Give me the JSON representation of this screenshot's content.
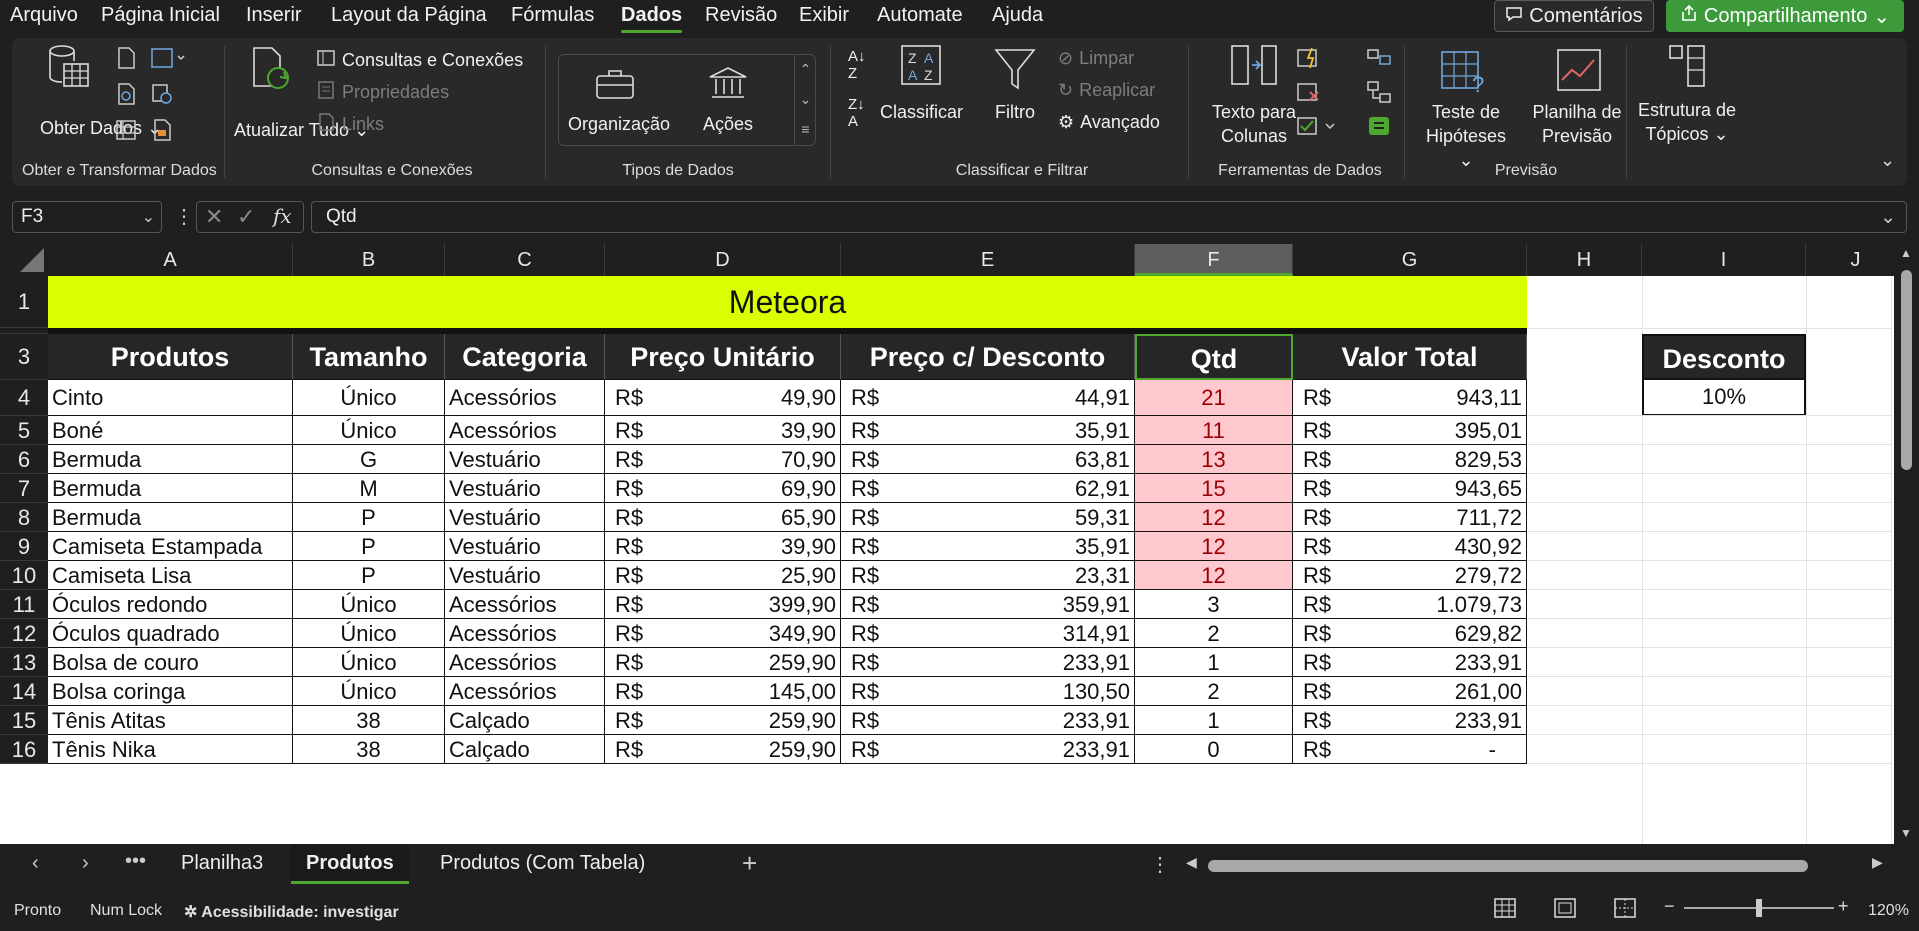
{
  "menu": [
    "Arquivo",
    "Página Inicial",
    "Inserir",
    "Layout da Página",
    "Fórmulas",
    "Dados",
    "Revisão",
    "Exibir",
    "Automate",
    "Ajuda"
  ],
  "active_menu": "Dados",
  "comments_label": "Comentários",
  "share_label": "Compartilhamento",
  "ribbon": {
    "obter_dados": "Obter Dados",
    "atualizar_tudo": "Atualizar Tudo",
    "consultas_conexoes_btn": "Consultas e Conexões",
    "propriedades": "Propriedades",
    "links": "Links",
    "organizacao": "Organização",
    "acoes": "Ações",
    "classificar": "Classificar",
    "filtro": "Filtro",
    "limpar": "Limpar",
    "reaplicar": "Reaplicar",
    "avancado": "Avançado",
    "texto_para_colunas": "Texto para Colunas",
    "teste_hipoteses": "Teste de Hipóteses",
    "planilha_previsao": "Planilha de Previsão",
    "estrutura_topicos": "Estrutura de Tópicos",
    "groups": {
      "obter": "Obter e Transformar Dados",
      "consultas": "Consultas e Conexões",
      "tipos": "Tipos de Dados",
      "classificar": "Classificar e Filtrar",
      "ferramentas": "Ferramentas de Dados",
      "previsao": "Previsão"
    }
  },
  "name_box": "F3",
  "formula_value": "Qtd",
  "columns": [
    "A",
    "B",
    "C",
    "D",
    "E",
    "F",
    "G",
    "H",
    "I",
    "J"
  ],
  "selected_column": "F",
  "title": "Meteora",
  "headers": [
    "Produtos",
    "Tamanho",
    "Categoria",
    "Preço Unitário",
    "Preço c/ Desconto",
    "Qtd",
    "Valor Total"
  ],
  "currency": "R$",
  "rows": [
    {
      "n": "4",
      "produto": "Cinto",
      "tamanho": "Único",
      "categoria": "Acessórios",
      "preco": "49,90",
      "desconto": "44,91",
      "qtd": "21",
      "total": "943,11"
    },
    {
      "n": "5",
      "produto": "Boné",
      "tamanho": "Único",
      "categoria": "Acessórios",
      "preco": "39,90",
      "desconto": "35,91",
      "qtd": "11",
      "total": "395,01"
    },
    {
      "n": "6",
      "produto": "Bermuda",
      "tamanho": "G",
      "categoria": "Vestuário",
      "preco": "70,90",
      "desconto": "63,81",
      "qtd": "13",
      "total": "829,53"
    },
    {
      "n": "7",
      "produto": "Bermuda",
      "tamanho": "M",
      "categoria": "Vestuário",
      "preco": "69,90",
      "desconto": "62,91",
      "qtd": "15",
      "total": "943,65"
    },
    {
      "n": "8",
      "produto": "Bermuda",
      "tamanho": "P",
      "categoria": "Vestuário",
      "preco": "65,90",
      "desconto": "59,31",
      "qtd": "12",
      "total": "711,72"
    },
    {
      "n": "9",
      "produto": "Camiseta Estampada",
      "tamanho": "P",
      "categoria": "Vestuário",
      "preco": "39,90",
      "desconto": "35,91",
      "qtd": "12",
      "total": "430,92"
    },
    {
      "n": "10",
      "produto": "Camiseta Lisa",
      "tamanho": "P",
      "categoria": "Vestuário",
      "preco": "25,90",
      "desconto": "23,31",
      "qtd": "12",
      "total": "279,72"
    },
    {
      "n": "11",
      "produto": "Óculos redondo",
      "tamanho": "Único",
      "categoria": "Acessórios",
      "preco": "399,90",
      "desconto": "359,91",
      "qtd": "3",
      "total": "1.079,73"
    },
    {
      "n": "12",
      "produto": "Óculos quadrado",
      "tamanho": "Único",
      "categoria": "Acessórios",
      "preco": "349,90",
      "desconto": "314,91",
      "qtd": "2",
      "total": "629,82"
    },
    {
      "n": "13",
      "produto": "Bolsa de couro",
      "tamanho": "Único",
      "categoria": "Acessórios",
      "preco": "259,90",
      "desconto": "233,91",
      "qtd": "1",
      "total": "233,91"
    },
    {
      "n": "14",
      "produto": "Bolsa coringa",
      "tamanho": "Único",
      "categoria": "Acessórios",
      "preco": "145,00",
      "desconto": "130,50",
      "qtd": "2",
      "total": "261,00"
    },
    {
      "n": "15",
      "produto": "Tênis Atitas",
      "tamanho": "38",
      "categoria": "Calçado",
      "preco": "259,90",
      "desconto": "233,91",
      "qtd": "1",
      "total": "233,91"
    },
    {
      "n": "16",
      "produto": "Tênis Nika",
      "tamanho": "38",
      "categoria": "Calçado",
      "preco": "259,90",
      "desconto": "233,91",
      "qtd": "0",
      "total": "-"
    }
  ],
  "discount": {
    "label": "Desconto",
    "value": "10%"
  },
  "tabs": [
    "Planilha3",
    "Produtos",
    "Produtos (Com Tabela)"
  ],
  "active_tab": "Produtos",
  "status": {
    "ready": "Pronto",
    "numlock": "Num Lock",
    "accessibility": "Acessibilidade: investigar",
    "zoom": "120%"
  },
  "colors": {
    "title_bg": "#d9ff00",
    "header_bg": "#262626",
    "highlight_bg": "#ffc7ce",
    "highlight_fg": "#9c0006",
    "accent": "#4ea72e"
  }
}
